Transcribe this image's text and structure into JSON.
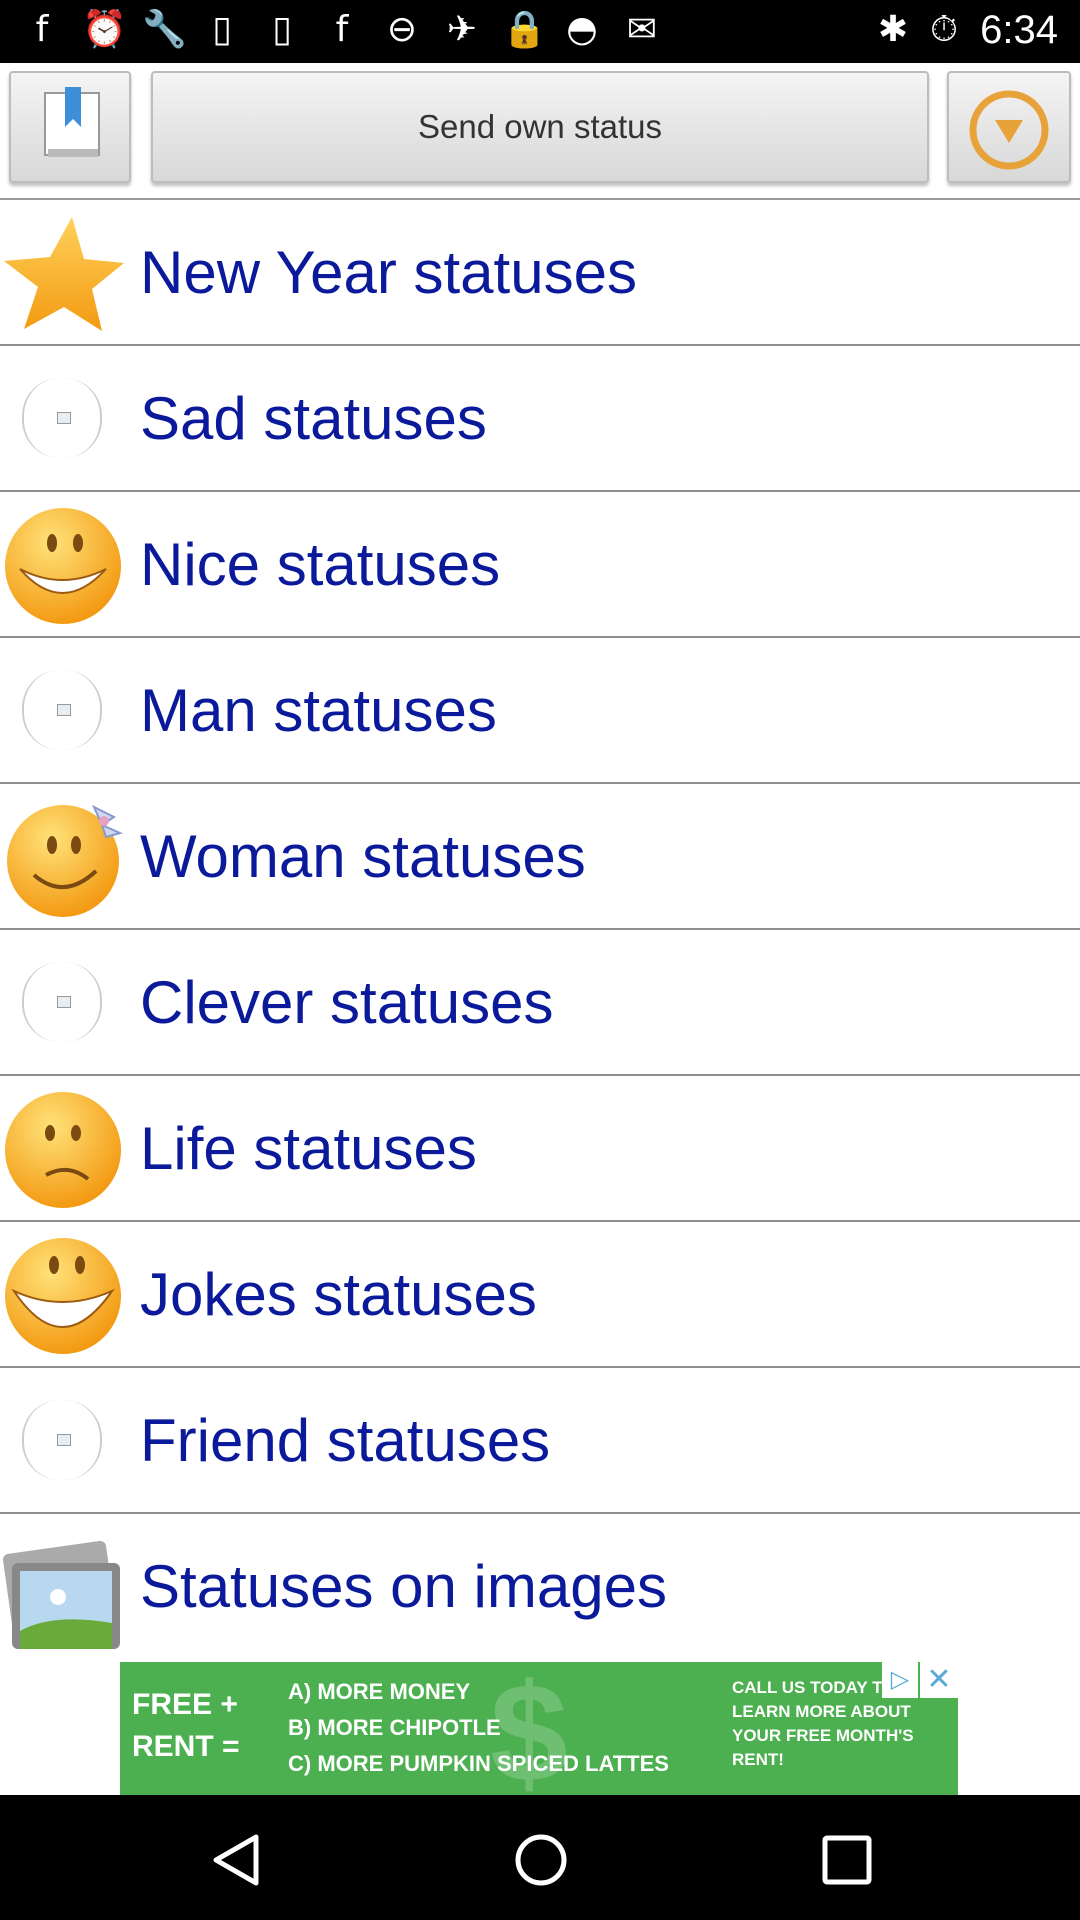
{
  "status_bar": {
    "time": "6:34",
    "icons": [
      "facebook-icon",
      "alarm-icon",
      "wrench-icon",
      "sim-icon",
      "sim-icon",
      "facebook-icon",
      "block-icon",
      "gps-icon",
      "lock-icon",
      "android-icon",
      "inbox-icon",
      "bluetooth-icon",
      "alarm-icon"
    ]
  },
  "toolbar": {
    "send_status_label": "Send own status",
    "left_icon": "bookmark-icon",
    "right_icon": "dropdown-icon"
  },
  "categories": [
    {
      "label": "New Year statuses",
      "icon": "star-icon"
    },
    {
      "label": "Sad statuses",
      "icon": "broken-image-icon"
    },
    {
      "label": "Nice statuses",
      "icon": "grin-smiley-icon"
    },
    {
      "label": "Man statuses",
      "icon": "broken-image-icon"
    },
    {
      "label": "Woman statuses",
      "icon": "bow-smiley-icon"
    },
    {
      "label": "Clever statuses",
      "icon": "broken-image-icon"
    },
    {
      "label": "Life statuses",
      "icon": "sad-smiley-icon"
    },
    {
      "label": "Jokes statuses",
      "icon": "laugh-smiley-icon"
    },
    {
      "label": "Friend statuses",
      "icon": "broken-image-icon"
    },
    {
      "label": "Statuses on images",
      "icon": "picture-icon"
    }
  ],
  "ad": {
    "left_line1": "FREE +",
    "left_line2": "RENT =",
    "mid_line1": "A) MORE MONEY",
    "mid_line2": "B) MORE CHIPOTLE",
    "mid_line3": "C) MORE PUMPKIN SPICED LATTES",
    "right_text": "CALL US TODAY TO LEARN MORE ABOUT YOUR FREE MONTH'S RENT!",
    "dollar": "$",
    "close": "✕",
    "play": "▷"
  },
  "colors": {
    "label_blue": "#0a1a9a",
    "ad_green": "#4caf50",
    "smiley_orange": "#f7a21c"
  }
}
